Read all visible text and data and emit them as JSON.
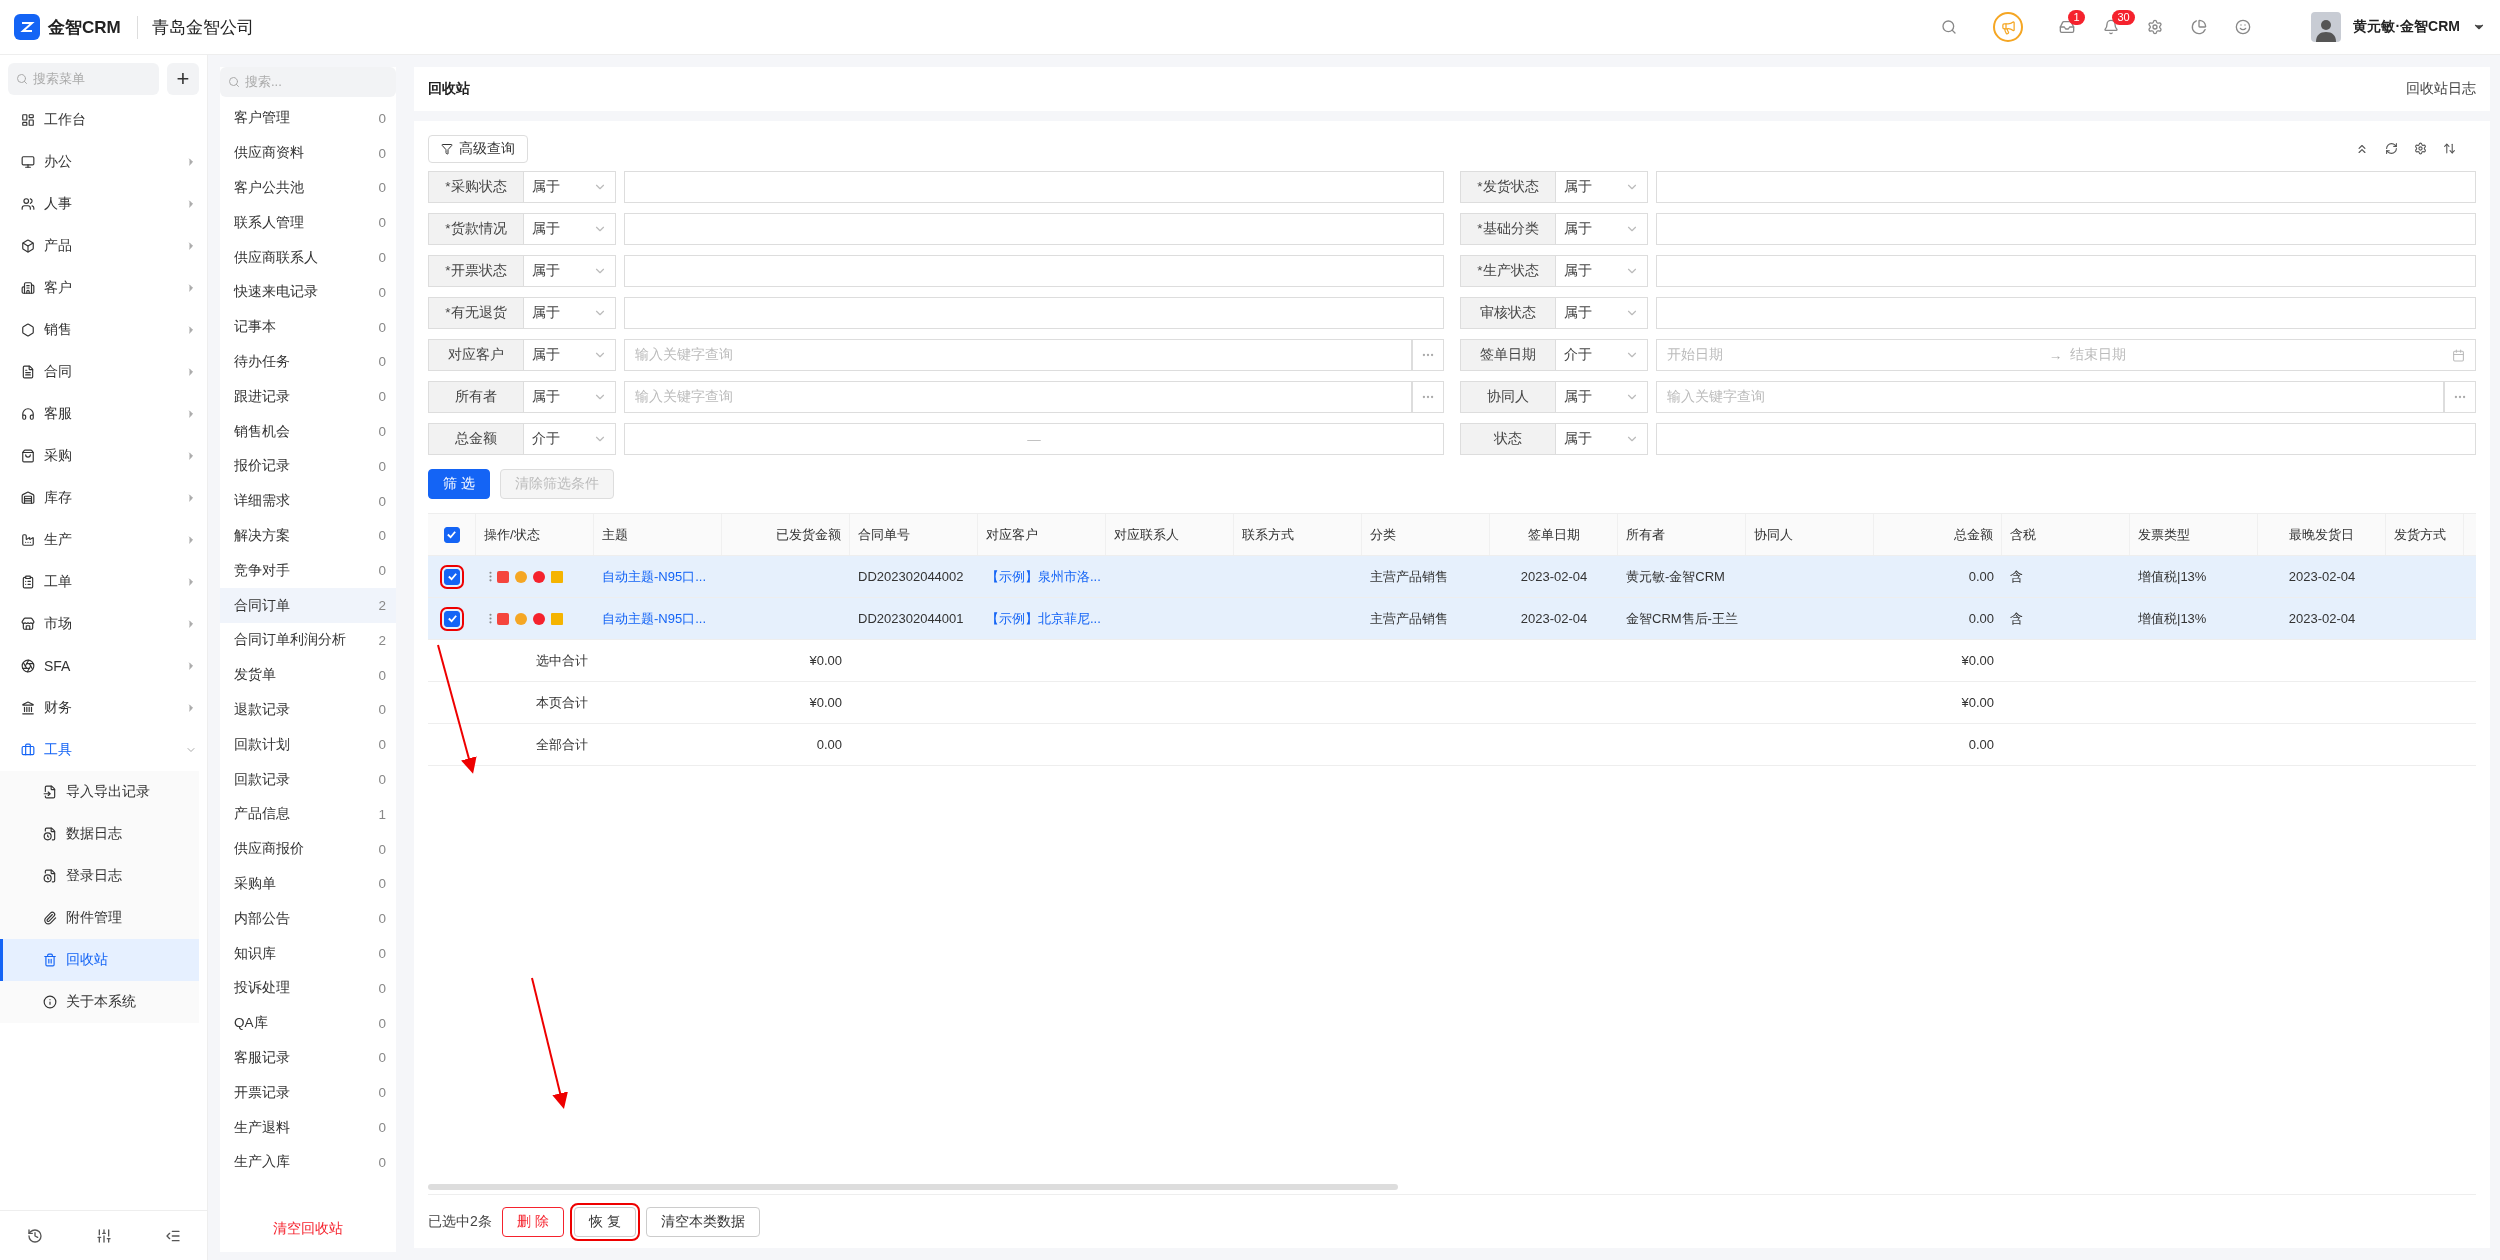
{
  "topbar": {
    "logo": "金智CRM",
    "company": "青岛金智公司",
    "mail_badge": "1",
    "bell_badge": "30",
    "user": "黄元敏·金智CRM"
  },
  "sidebar": {
    "search_placeholder": "搜索菜单",
    "add_label": "+",
    "items": [
      {
        "label": "工作台",
        "selected": false
      },
      {
        "label": "办公",
        "selected": false,
        "expanded": false
      },
      {
        "label": "人事",
        "selected": false,
        "expanded": false
      },
      {
        "label": "产品",
        "selected": false,
        "expanded": false
      },
      {
        "label": "客户",
        "selected": false,
        "expanded": false
      },
      {
        "label": "销售",
        "selected": false,
        "expanded": false
      },
      {
        "label": "合同",
        "selected": false,
        "expanded": false
      },
      {
        "label": "客服",
        "selected": false,
        "expanded": false
      },
      {
        "label": "采购",
        "selected": false,
        "expanded": false
      },
      {
        "label": "库存",
        "selected": false,
        "expanded": false
      },
      {
        "label": "生产",
        "selected": false,
        "expanded": false
      },
      {
        "label": "工单",
        "selected": false,
        "expanded": false
      },
      {
        "label": "市场",
        "selected": false,
        "expanded": false
      },
      {
        "label": "SFA",
        "selected": false,
        "expanded": false
      },
      {
        "label": "财务",
        "selected": false,
        "expanded": false
      },
      {
        "label": "工具",
        "selected": false,
        "expanded": true,
        "children": [
          {
            "label": "导入导出记录",
            "selected": false
          },
          {
            "label": "数据日志",
            "selected": false
          },
          {
            "label": "登录日志",
            "selected": false
          },
          {
            "label": "附件管理",
            "selected": false
          },
          {
            "label": "回收站",
            "selected": true
          },
          {
            "label": "关于本系统",
            "selected": false
          }
        ]
      }
    ]
  },
  "categories": {
    "search_placeholder": "搜索...",
    "clear_label": "清空回收站",
    "items": [
      {
        "name": "客户管理",
        "count": "0",
        "selected": false
      },
      {
        "name": "供应商资料",
        "count": "0",
        "selected": false
      },
      {
        "name": "客户公共池",
        "count": "0",
        "selected": false
      },
      {
        "name": "联系人管理",
        "count": "0",
        "selected": false
      },
      {
        "name": "供应商联系人",
        "count": "0",
        "selected": false
      },
      {
        "name": "快速来电记录",
        "count": "0",
        "selected": false
      },
      {
        "name": "记事本",
        "count": "0",
        "selected": false
      },
      {
        "name": "待办任务",
        "count": "0",
        "selected": false
      },
      {
        "name": "跟进记录",
        "count": "0",
        "selected": false
      },
      {
        "name": "销售机会",
        "count": "0",
        "selected": false
      },
      {
        "name": "报价记录",
        "count": "0",
        "selected": false
      },
      {
        "name": "详细需求",
        "count": "0",
        "selected": false
      },
      {
        "name": "解决方案",
        "count": "0",
        "selected": false
      },
      {
        "name": "竞争对手",
        "count": "0",
        "selected": false
      },
      {
        "name": "合同订单",
        "count": "2",
        "selected": true
      },
      {
        "name": "合同订单利润分析",
        "count": "2",
        "selected": false
      },
      {
        "name": "发货单",
        "count": "0",
        "selected": false
      },
      {
        "name": "退款记录",
        "count": "0",
        "selected": false
      },
      {
        "name": "回款计划",
        "count": "0",
        "selected": false
      },
      {
        "name": "回款记录",
        "count": "0",
        "selected": false
      },
      {
        "name": "产品信息",
        "count": "1",
        "selected": false
      },
      {
        "name": "供应商报价",
        "count": "0",
        "selected": false
      },
      {
        "name": "采购单",
        "count": "0",
        "selected": false
      },
      {
        "name": "内部公告",
        "count": "0",
        "selected": false
      },
      {
        "name": "知识库",
        "count": "0",
        "selected": false
      },
      {
        "name": "投诉处理",
        "count": "0",
        "selected": false
      },
      {
        "name": "QA库",
        "count": "0",
        "selected": false
      },
      {
        "name": "客服记录",
        "count": "0",
        "selected": false
      },
      {
        "name": "开票记录",
        "count": "0",
        "selected": false
      },
      {
        "name": "生产退料",
        "count": "0",
        "selected": false
      },
      {
        "name": "生产入库",
        "count": "0",
        "selected": false
      }
    ]
  },
  "page": {
    "title": "回收站",
    "log_link": "回收站日志"
  },
  "filters": {
    "advanced_label": "高级查询",
    "submit_label": "筛 选",
    "clear_label": "清除筛选条件",
    "left": [
      {
        "label": "*采购状态",
        "operator": "属于",
        "kind": "text"
      },
      {
        "label": "*货款情况",
        "operator": "属于",
        "kind": "text"
      },
      {
        "label": "*开票状态",
        "operator": "属于",
        "kind": "text"
      },
      {
        "label": "*有无退货",
        "operator": "属于",
        "kind": "text"
      },
      {
        "label": "对应客户",
        "operator": "属于",
        "kind": "lookup",
        "placeholder": "输入关键字查询"
      },
      {
        "label": "所有者",
        "operator": "属于",
        "kind": "lookup",
        "placeholder": "输入关键字查询"
      },
      {
        "label": "总金额",
        "operator": "介于",
        "kind": "range",
        "separator": "—"
      }
    ],
    "right": [
      {
        "label": "*发货状态",
        "operator": "属于",
        "kind": "text"
      },
      {
        "label": "*基础分类",
        "operator": "属于",
        "kind": "text"
      },
      {
        "label": "*生产状态",
        "operator": "属于",
        "kind": "text"
      },
      {
        "label": "审核状态",
        "operator": "属于",
        "kind": "text"
      },
      {
        "label": "签单日期",
        "operator": "介于",
        "kind": "date",
        "start_placeholder": "开始日期",
        "arrow": "→",
        "end_placeholder": "结束日期"
      },
      {
        "label": "协同人",
        "operator": "属于",
        "kind": "lookup",
        "placeholder": "输入关键字查询"
      },
      {
        "label": "状态",
        "operator": "属于",
        "kind": "text"
      }
    ]
  },
  "table": {
    "all_checked": true,
    "columns": [
      "操作/状态",
      "主题",
      "已发货金额",
      "合同单号",
      "对应客户",
      "对应联系人",
      "联系方式",
      "分类",
      "签单日期",
      "所有者",
      "协同人",
      "总金额",
      "含税",
      "发票类型",
      "最晚发货日",
      "发货方式"
    ],
    "rows": [
      {
        "checked": true,
        "annotated": true,
        "cells": [
          "",
          "自动主题-N95口...",
          "",
          "DD202302044002",
          "【示例】泉州市洛...",
          "",
          "",
          "主营产品销售",
          "2023-02-04",
          "黄元敏-金智CRM",
          "",
          "0.00",
          "含",
          "增值税|13%",
          "2023-02-04",
          ""
        ]
      },
      {
        "checked": true,
        "annotated": true,
        "cells": [
          "",
          "自动主题-N95口...",
          "",
          "DD202302044001",
          "【示例】北京菲尼...",
          "",
          "",
          "主营产品销售",
          "2023-02-04",
          "金智CRM售后-王兰",
          "",
          "0.00",
          "含",
          "增值税|13%",
          "2023-02-04",
          ""
        ]
      }
    ],
    "totals": [
      {
        "label": "选中合计",
        "shipped": "¥0.00",
        "total": "¥0.00"
      },
      {
        "label": "本页合计",
        "shipped": "¥0.00",
        "total": "¥0.00"
      },
      {
        "label": "全部合计",
        "shipped": "0.00",
        "total": "0.00"
      }
    ]
  },
  "footer": {
    "selected_text": "已选中2条",
    "buttons": [
      {
        "label": "删 除",
        "kind": "danger",
        "annotated": false
      },
      {
        "label": "恢 复",
        "kind": "default",
        "annotated": true
      },
      {
        "label": "清空本类数据",
        "kind": "default",
        "annotated": false
      }
    ]
  }
}
